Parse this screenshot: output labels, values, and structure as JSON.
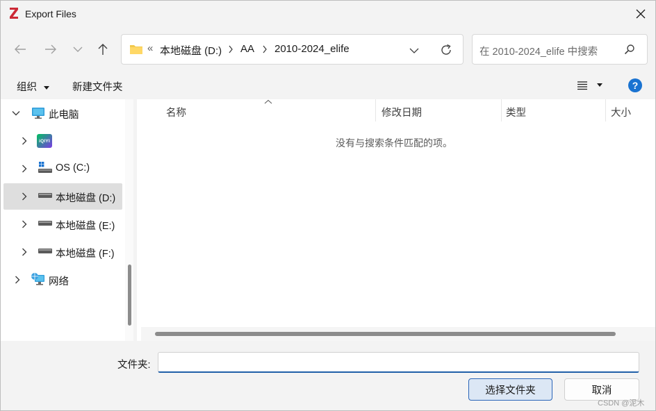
{
  "window": {
    "title": "Export Files",
    "close_icon": "close-icon"
  },
  "nav": {
    "back_icon": "arrow-left-icon",
    "forward_icon": "arrow-right-icon",
    "recent_icon": "chevron-down-icon",
    "up_icon": "arrow-up-icon"
  },
  "address": {
    "prefix": "«",
    "crumbs": [
      "本地磁盘 (D:)",
      "AA",
      "2010-2024_elife"
    ]
  },
  "search": {
    "placeholder": "在 2010-2024_elife 中搜索"
  },
  "toolbar": {
    "organize_label": "组织",
    "new_folder_label": "新建文件夹",
    "help_label": "?"
  },
  "sidebar": {
    "items": [
      {
        "label": "此电脑",
        "icon": "monitor-icon"
      },
      {
        "label": "iQIYI",
        "icon": "iqiyi-icon"
      },
      {
        "label": "OS (C:)",
        "icon": "windows-drive-icon"
      },
      {
        "label": "本地磁盘 (D:)",
        "icon": "drive-icon"
      },
      {
        "label": "本地磁盘 (E:)",
        "icon": "drive-icon"
      },
      {
        "label": "本地磁盘 (F:)",
        "icon": "drive-icon"
      },
      {
        "label": "网络",
        "icon": "network-icon"
      }
    ]
  },
  "list": {
    "columns": [
      "名称",
      "修改日期",
      "类型",
      "大小"
    ],
    "empty_message": "没有与搜索条件匹配的项。"
  },
  "footer": {
    "folder_label": "文件夹:",
    "folder_value": "",
    "select_button": "选择文件夹",
    "cancel_button": "取消"
  },
  "watermark": "CSDN @泥木",
  "colors": {
    "accent": "#1f5fa8",
    "help": "#1a73d1",
    "selected_bg": "#dedede",
    "primary_button_bg": "#dce7f5"
  }
}
